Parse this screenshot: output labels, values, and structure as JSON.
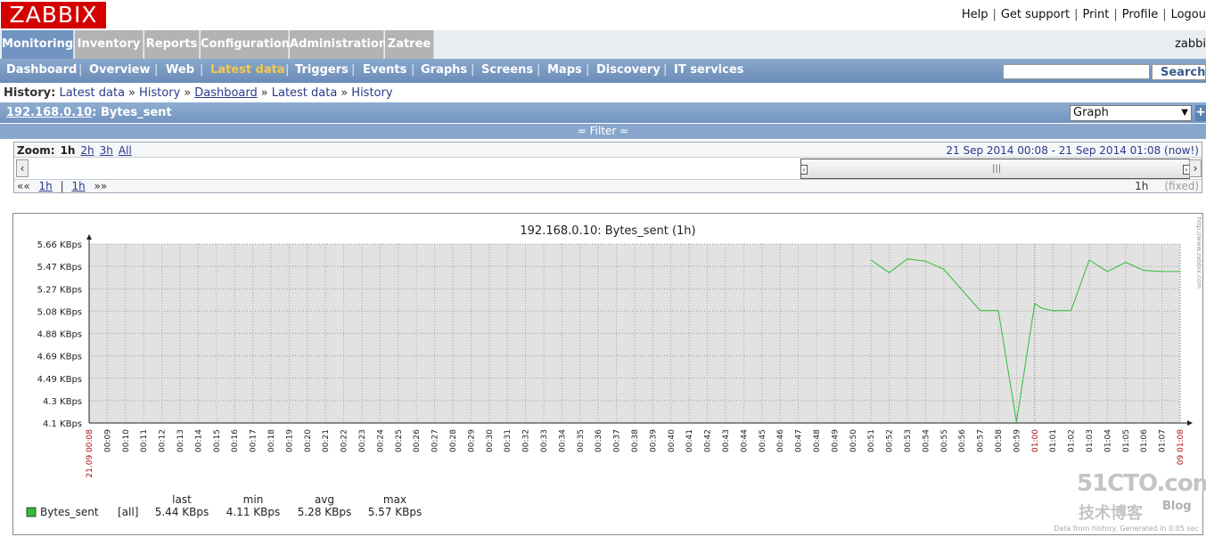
{
  "app": {
    "logo": "ZABBIX",
    "user": "zabbi"
  },
  "header_links": [
    "Help",
    "Get support",
    "Print",
    "Profile",
    "Logou"
  ],
  "main_menu": [
    "Monitoring",
    "Inventory",
    "Reports",
    "Configuration",
    "Administration",
    "Zatree"
  ],
  "sub_menu": [
    "Dashboard",
    "Overview",
    "Web",
    "Latest data",
    "Triggers",
    "Events",
    "Graphs",
    "Screens",
    "Maps",
    "Discovery",
    "IT services"
  ],
  "search": {
    "button": "Search",
    "value": ""
  },
  "breadcrumb": {
    "label": "History:",
    "items": [
      "Latest data",
      "History",
      "Dashboard",
      "Latest data",
      "History"
    ]
  },
  "title": {
    "host": "192.168.0.10",
    "item": ": Bytes_sent"
  },
  "graph_select": {
    "value": "Graph"
  },
  "filter": {
    "label": "≈ Filter ≈"
  },
  "zoom": {
    "label": "Zoom:",
    "options": [
      "1h",
      "2h",
      "3h",
      "All"
    ],
    "period": "21 Sep 2014 00:08  -  21 Sep 2014 01:08 (now!)"
  },
  "nav": {
    "back": "««",
    "step1": "1h",
    "sep": "|",
    "step2": "1h",
    "fwd": "»»",
    "period": "1h",
    "fixed": "(fixed)"
  },
  "chart_data": {
    "type": "line",
    "title": "192.168.0.10: Bytes_sent (1h)",
    "y_ticks": [
      "5.66 KBps",
      "5.47 KBps",
      "5.27 KBps",
      "5.08 KBps",
      "4.88 KBps",
      "4.69 KBps",
      "4.49 KBps",
      "4.3 KBps",
      "4.1 KBps"
    ],
    "ylim": [
      4.1,
      5.66
    ],
    "x_ticks": [
      "21.09 00:08",
      "00:09",
      "00:10",
      "00:11",
      "00:12",
      "00:13",
      "00:14",
      "00:15",
      "00:16",
      "00:17",
      "00:18",
      "00:19",
      "00:20",
      "00:21",
      "00:22",
      "00:23",
      "00:24",
      "00:25",
      "00:26",
      "00:27",
      "00:28",
      "00:29",
      "00:30",
      "00:31",
      "00:32",
      "00:33",
      "00:34",
      "00:35",
      "00:36",
      "00:37",
      "00:38",
      "00:39",
      "00:40",
      "00:41",
      "00:42",
      "00:43",
      "00:44",
      "00:45",
      "00:46",
      "00:47",
      "00:48",
      "00:49",
      "00:50",
      "00:51",
      "00:52",
      "00:53",
      "00:54",
      "00:55",
      "00:56",
      "00:57",
      "00:58",
      "00:59",
      "01:00",
      "01:01",
      "01:02",
      "01:03",
      "01:04",
      "01:05",
      "01:06",
      "01:07",
      "09 01:08"
    ],
    "highlight_ticks": [
      "21.09 00:08",
      "01:00",
      "09 01:08"
    ],
    "series": [
      {
        "name": "Bytes_sent",
        "color": "#33bb33",
        "x": [
          43,
          44,
          45,
          46,
          47,
          48,
          49,
          50,
          51,
          52,
          52.4,
          53,
          54,
          55,
          56,
          57,
          58,
          59,
          60
        ],
        "y": [
          5.52,
          5.41,
          5.53,
          5.51,
          5.44,
          5.26,
          5.08,
          5.08,
          4.11,
          5.14,
          5.1,
          5.08,
          5.08,
          5.52,
          5.42,
          5.5,
          5.43,
          5.42,
          5.42
        ]
      }
    ],
    "legend": {
      "name": "Bytes_sent",
      "func": "[all]",
      "headers": [
        "last",
        "min",
        "avg",
        "max"
      ],
      "values": [
        "5.44 KBps",
        "4.11 KBps",
        "5.28 KBps",
        "5.57 KBps"
      ]
    },
    "side_note": "http://www.zabbix.com",
    "footer": "Data from history. Generated in 0.05 sec"
  },
  "watermark": {
    "line1": "51CTO.com",
    "line2": "技术博客",
    "line3": "Blog"
  }
}
